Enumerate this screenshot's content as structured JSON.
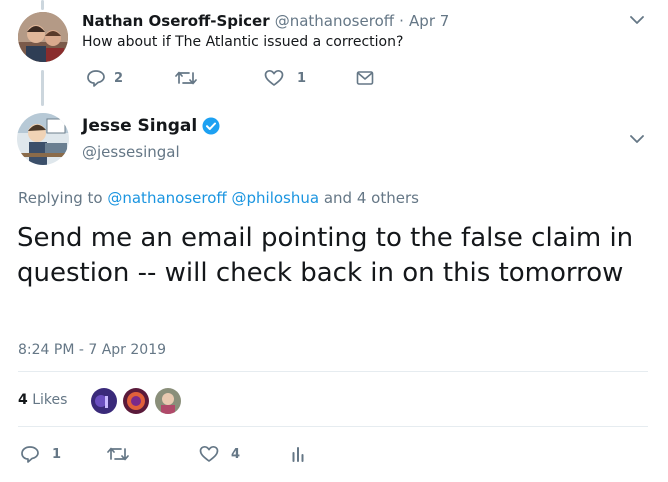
{
  "reply_tweet": {
    "name": "Nathan Oseroff-Spicer",
    "handle": "@nathanoseroff",
    "separator": "·",
    "date": "Apr 7",
    "text": "How about if The Atlantic issued a correction?",
    "reply_count": "2",
    "retweet_count": "",
    "like_count": "1"
  },
  "main_tweet": {
    "name": "Jesse Singal",
    "handle": "@jessesingal",
    "replying_prefix": "Replying to",
    "replying_user1": "@nathanoseroff",
    "replying_user2": "@philoshua",
    "replying_suffix": "and 4 others",
    "text": "Send me an email pointing to the false claim in question -- will check back in on this tomorrow",
    "timestamp": "8:24 PM - 7 Apr 2019",
    "likes_count": "4",
    "likes_label": "Likes",
    "reply_count": "1",
    "retweet_count": "",
    "like_count": "4"
  },
  "colors": {
    "link": "#1b95e0",
    "muted": "#657786",
    "verified": "#1da1f2",
    "divider": "#e6ecf0"
  },
  "icons": [
    "reply-icon",
    "retweet-icon",
    "heart-icon",
    "message-icon",
    "chevron-down-icon",
    "verified-badge-icon",
    "analytics-icon"
  ]
}
